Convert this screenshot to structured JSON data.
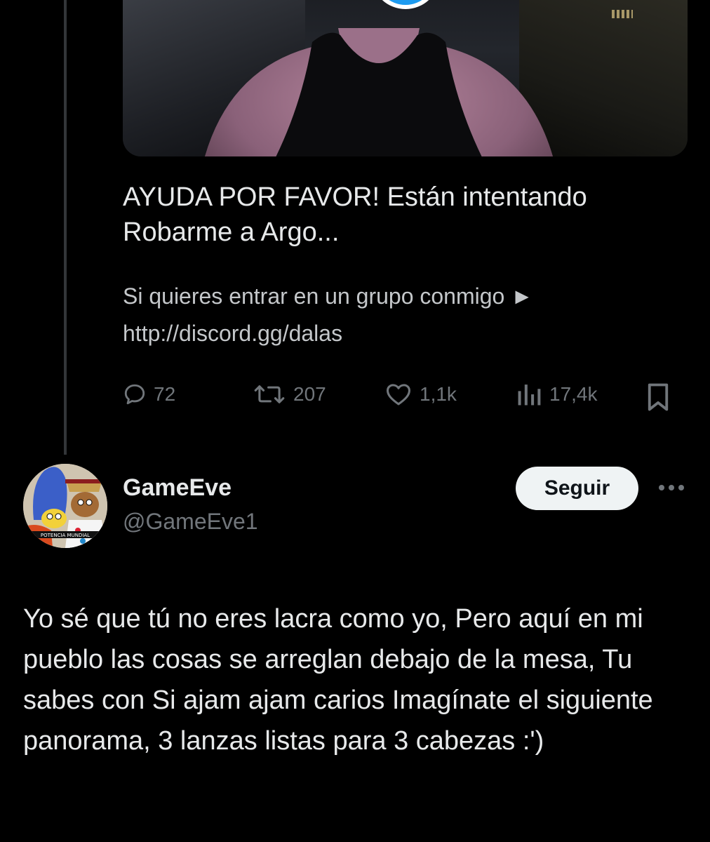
{
  "quoted_tweet": {
    "media": {
      "type": "video",
      "play_icon": "play-icon"
    },
    "title": "AYUDA POR FAVOR! Están intentando Robarme a Argo...",
    "description_line1": "Si quieres entrar en un grupo conmigo ►",
    "description_line2": "http://discord.gg/dalas",
    "actions": {
      "replies": "72",
      "retweets": "207",
      "likes": "1,1k",
      "views": "17,4k"
    }
  },
  "reply": {
    "author": {
      "name": "GameEve",
      "handle": "@GameEve1",
      "avatar_caption": "POTENCIA MUNDIAL"
    },
    "follow_label": "Seguir",
    "text": "Yo sé que tú no eres lacra como yo, Pero aquí en mi pueblo las cosas se arreglan debajo de la mesa, Tu sabes con Si ajam ajam carios Imagínate el siguiente panorama, 3 lanzas listas para 3 cabezas :')"
  },
  "colors": {
    "background": "#000000",
    "primary_text": "#e7e9ea",
    "secondary_text": "#71767b",
    "accent": "#1d9bf0",
    "follow_button_bg": "#eff3f4"
  }
}
